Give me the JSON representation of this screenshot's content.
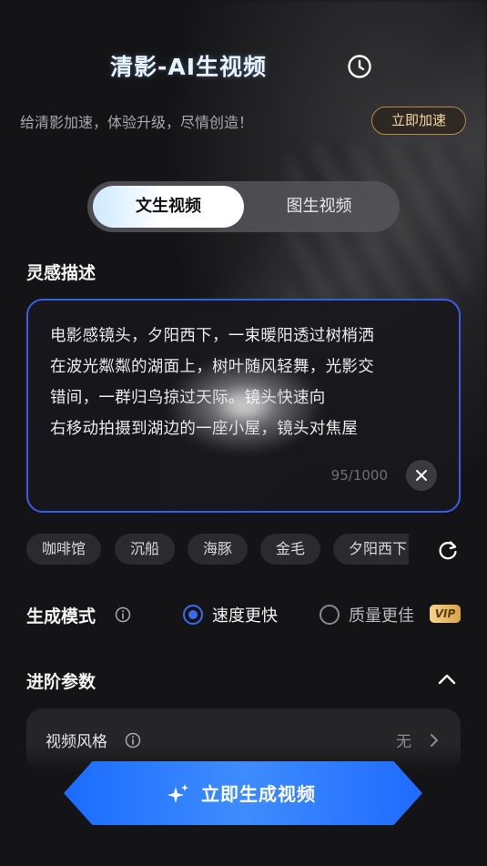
{
  "header": {
    "title": "清影-AI生视频",
    "promo_text": "给清影加速，体验升级，尽情创造！",
    "speed_button": "立即加速"
  },
  "mode_tabs": {
    "items": [
      {
        "label": "文生视频",
        "active": true
      },
      {
        "label": "图生视频",
        "active": false
      }
    ]
  },
  "prompt": {
    "section_label": "灵感描述",
    "text": "电影感镜头，夕阳西下，一束暖阳透过树梢洒\n在波光粼粼的湖面上，树叶随风轻舞，光影交\n错间，一群归鸟掠过天际。镜头快速向\n右移动拍摄到湖边的一座小屋，镜头对焦屋",
    "char_count": "95/1000"
  },
  "suggestion_chips": [
    "咖啡馆",
    "沉船",
    "海豚",
    "金毛",
    "夕阳西下"
  ],
  "generation_mode": {
    "label": "生成模式",
    "options": [
      {
        "label": "速度更快",
        "selected": true
      },
      {
        "label": "质量更佳",
        "selected": false
      }
    ],
    "vip_badge": "VIP"
  },
  "advanced": {
    "label": "进阶参数",
    "expanded": true,
    "video_style_label": "视频风格",
    "video_style_value": "无"
  },
  "generate_button": "立即生成视频",
  "colors": {
    "accent_blue": "#3b6cf0",
    "gold": "#b58b4a",
    "background": "#141416"
  }
}
